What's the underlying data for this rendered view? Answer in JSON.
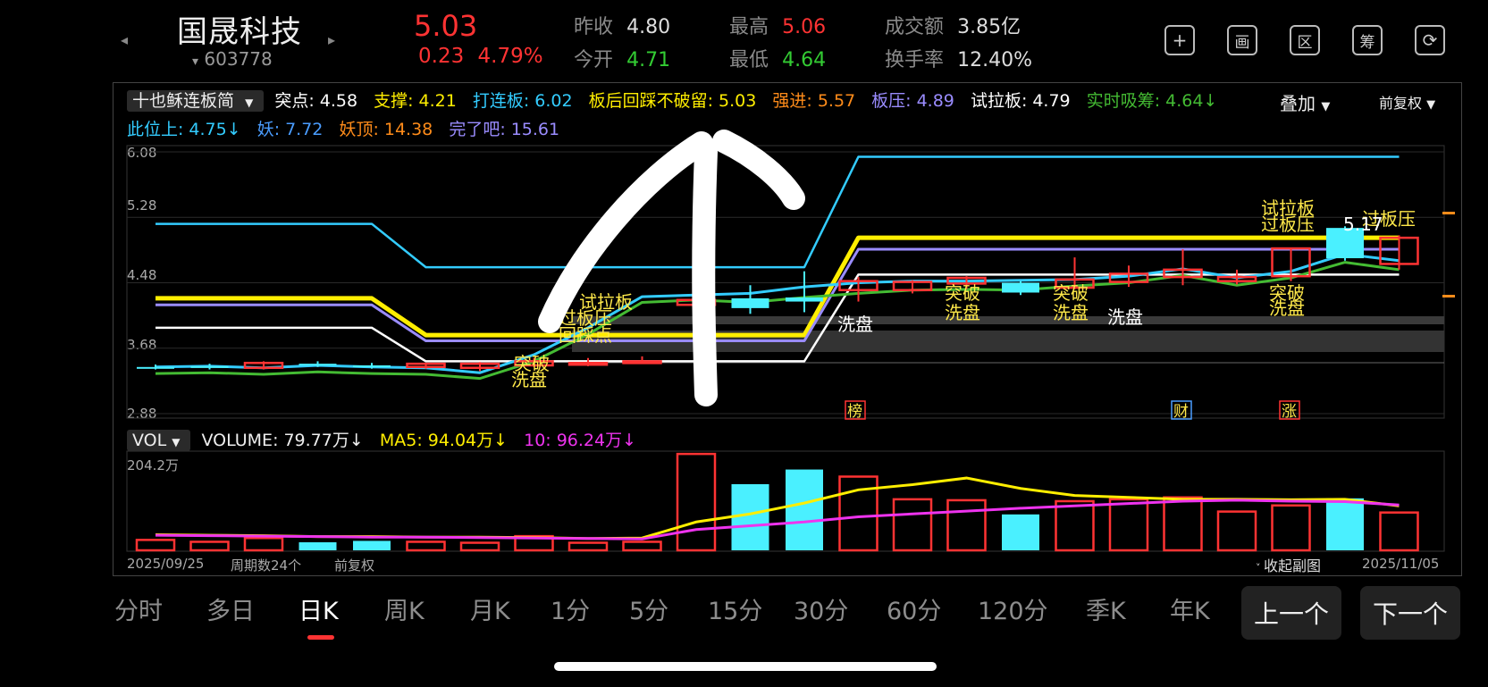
{
  "header": {
    "prev_arrow": "◂",
    "next_arrow": "▸",
    "name": "国晟科技",
    "code_caret": "▾",
    "code": "603778",
    "price": "5.03",
    "change": "0.23",
    "change_pct": "4.79%",
    "stats": {
      "prev_close_label": "昨收",
      "prev_close": "4.80",
      "open_label": "今开",
      "open": "4.71",
      "high_label": "最高",
      "high": "5.06",
      "low_label": "最低",
      "low": "4.64",
      "amount_label": "成交额",
      "amount": "3.85亿",
      "turnover_label": "换手率",
      "turnover": "12.40%"
    },
    "icons": [
      {
        "name": "add-icon",
        "glyph": "+"
      },
      {
        "name": "draw-icon",
        "glyph": "画"
      },
      {
        "name": "range-icon",
        "glyph": "区"
      },
      {
        "name": "chip-icon",
        "glyph": "筹"
      },
      {
        "name": "rotate-icon",
        "glyph": "⟳"
      }
    ]
  },
  "colors": {
    "up": "#ff3333",
    "down": "#33cc33",
    "yellow": "#ffee00",
    "cyan": "#33ccff",
    "purple": "#9a8cff",
    "white": "#ffffff",
    "green": "#44bb33",
    "orange": "#ff8c1a",
    "magenta": "#ee33ee",
    "candle_cyan": "#4af0ff"
  },
  "indicator": {
    "selector": "十也稣连板简",
    "items_row1": [
      {
        "label": "突点:",
        "value": "4.58",
        "color": "#ffffff"
      },
      {
        "label": "支撑:",
        "value": "4.21",
        "color": "#ffee00"
      },
      {
        "label": "打连板:",
        "value": "6.02",
        "color": "#33ccff"
      },
      {
        "label": "板后回踩不破留:",
        "value": "5.03",
        "color": "#ffee00"
      },
      {
        "label": "强进:",
        "value": "5.57",
        "color": "#ff8c1a"
      },
      {
        "label": "板压:",
        "value": "4.89",
        "color": "#9a8cff"
      },
      {
        "label": "试拉板:",
        "value": "4.79",
        "color": "#ffffff"
      },
      {
        "label": "实时吸筹:",
        "value": "4.64↓",
        "color": "#44bb33"
      }
    ],
    "items_row2": [
      {
        "label": "此位上:",
        "value": "4.75↓",
        "color": "#33ccff"
      },
      {
        "label": "妖:",
        "value": "7.72",
        "color": "#4a9dff"
      },
      {
        "label": "妖顶:",
        "value": "14.38",
        "color": "#ff8c1a"
      },
      {
        "label": "完了吧:",
        "value": "15.61",
        "color": "#9a8cff"
      }
    ],
    "overlay": "叠加",
    "adjust": "前复权"
  },
  "price_axis": [
    "6.08",
    "5.28",
    "4.48",
    "3.68",
    "2.88"
  ],
  "annotations": {
    "tulaban": "试拉板",
    "guobanya": "过板压",
    "xipan": "洗盘",
    "tupo": "突破",
    "huicaidian": "回踩点",
    "bang": "榜",
    "cai": "财",
    "zhang": "涨",
    "last_close_hint": "5.17"
  },
  "volume": {
    "selector": "VOL",
    "volume_label": "VOLUME:",
    "volume_value": "79.77万↓",
    "ma5_label": "MA5:",
    "ma5_value": "94.04万↓",
    "ma10_label": "10:",
    "ma10_value": "96.24万↓",
    "axis_max": "204.2万"
  },
  "footer": {
    "start_date": "2025/09/25",
    "period_count": "周期数24个",
    "adjust": "前复权",
    "collapse": "收起副图",
    "end_date": "2025/11/05"
  },
  "tabs": [
    "分时",
    "多日",
    "日K",
    "周K",
    "月K",
    "1分",
    "5分",
    "15分",
    "30分",
    "60分",
    "120分",
    "季K",
    "年K"
  ],
  "active_tab": "日K",
  "nav": {
    "prev": "上一个",
    "next": "下一个"
  },
  "chart_data": {
    "type": "candlestick",
    "x": [
      "2025/09/25",
      "",
      "",
      "",
      "",
      "",
      "",
      "",
      "",
      "",
      "",
      "",
      "",
      "",
      "",
      "",
      "",
      "",
      "",
      "",
      "",
      "",
      "",
      "2025/11/05"
    ],
    "ylim": [
      2.88,
      6.08
    ],
    "candles": [
      {
        "o": 3.45,
        "c": 3.45,
        "h": 3.48,
        "l": 3.42,
        "up": false
      },
      {
        "o": 3.46,
        "c": 3.44,
        "h": 3.49,
        "l": 3.42,
        "up": false
      },
      {
        "o": 3.44,
        "c": 3.5,
        "h": 3.52,
        "l": 3.42,
        "up": true
      },
      {
        "o": 3.49,
        "c": 3.47,
        "h": 3.52,
        "l": 3.45,
        "up": false
      },
      {
        "o": 3.47,
        "c": 3.45,
        "h": 3.5,
        "l": 3.43,
        "up": false
      },
      {
        "o": 3.45,
        "c": 3.49,
        "h": 3.5,
        "l": 3.43,
        "up": true
      },
      {
        "o": 3.44,
        "c": 3.49,
        "h": 3.51,
        "l": 3.4,
        "up": true
      },
      {
        "o": 3.47,
        "c": 3.52,
        "h": 3.56,
        "l": 3.45,
        "up": true
      },
      {
        "o": 3.5,
        "c": 3.5,
        "h": 3.56,
        "l": 3.46,
        "up": true
      },
      {
        "o": 3.52,
        "c": 3.52,
        "h": 3.58,
        "l": 3.49,
        "up": true
      },
      {
        "o": 4.21,
        "c": 4.27,
        "h": 4.3,
        "l": 4.21,
        "up": true
      },
      {
        "o": 4.29,
        "c": 4.17,
        "h": 4.45,
        "l": 4.1,
        "up": false
      },
      {
        "o": 4.3,
        "c": 4.25,
        "h": 4.62,
        "l": 4.12,
        "up": false
      },
      {
        "o": 4.39,
        "c": 4.5,
        "h": 4.55,
        "l": 4.25,
        "up": true
      },
      {
        "o": 4.39,
        "c": 4.49,
        "h": 4.51,
        "l": 4.35,
        "up": true
      },
      {
        "o": 4.47,
        "c": 4.54,
        "h": 4.56,
        "l": 4.4,
        "up": true
      },
      {
        "o": 4.48,
        "c": 4.36,
        "h": 4.5,
        "l": 4.33,
        "up": false
      },
      {
        "o": 4.42,
        "c": 4.52,
        "h": 4.79,
        "l": 4.4,
        "up": true
      },
      {
        "o": 4.49,
        "c": 4.59,
        "h": 4.69,
        "l": 4.43,
        "up": true
      },
      {
        "o": 4.55,
        "c": 4.64,
        "h": 4.89,
        "l": 4.45,
        "up": true
      },
      {
        "o": 4.55,
        "c": 4.5,
        "h": 4.64,
        "l": 4.46,
        "up": true
      },
      {
        "o": 4.9,
        "c": 4.56,
        "h": 4.9,
        "l": 4.5,
        "up": true
      },
      {
        "o": 5.15,
        "c": 4.78,
        "h": 5.17,
        "l": 4.75,
        "up": false
      },
      {
        "o": 4.71,
        "c": 5.03,
        "h": 5.06,
        "l": 4.64,
        "up": true
      }
    ],
    "series": [
      {
        "name": "打连板",
        "values": [
          5.2,
          5.2,
          5.2,
          5.2,
          5.2,
          4.67,
          4.67,
          4.67,
          4.67,
          4.67,
          4.67,
          4.67,
          4.67,
          6.02,
          6.02,
          6.02,
          6.02,
          6.02,
          6.02,
          6.02,
          6.02,
          6.02,
          6.02,
          6.02
        ]
      },
      {
        "name": "板后回踩不破留",
        "values": [
          4.29,
          4.29,
          4.29,
          4.29,
          4.29,
          3.84,
          3.84,
          3.84,
          3.84,
          3.84,
          3.84,
          3.84,
          3.84,
          5.03,
          5.03,
          5.03,
          5.03,
          5.03,
          5.03,
          5.03,
          5.03,
          5.03,
          5.03,
          5.03
        ]
      },
      {
        "name": "板压",
        "values": [
          4.21,
          4.21,
          4.21,
          4.21,
          4.21,
          3.77,
          3.77,
          3.77,
          3.77,
          3.77,
          3.77,
          3.77,
          3.77,
          4.89,
          4.89,
          4.89,
          4.89,
          4.89,
          4.89,
          4.89,
          4.89,
          4.89,
          4.89,
          4.89
        ]
      },
      {
        "name": "突点",
        "values": [
          3.93,
          3.93,
          3.93,
          3.93,
          3.93,
          3.52,
          3.52,
          3.52,
          3.52,
          3.52,
          3.52,
          3.52,
          3.52,
          4.58,
          4.58,
          4.58,
          4.58,
          4.58,
          4.58,
          4.58,
          4.58,
          4.58,
          4.58,
          4.58
        ]
      },
      {
        "name": "此位上",
        "values": [
          3.45,
          3.46,
          3.44,
          3.47,
          3.45,
          3.44,
          3.38,
          3.6,
          3.93,
          4.31,
          4.33,
          4.35,
          4.43,
          4.48,
          4.5,
          4.5,
          4.51,
          4.52,
          4.56,
          4.65,
          4.54,
          4.62,
          4.83,
          4.75
        ]
      },
      {
        "name": "实时吸筹",
        "values": [
          3.37,
          3.38,
          3.36,
          3.39,
          3.37,
          3.36,
          3.31,
          3.52,
          3.85,
          4.24,
          4.27,
          4.24,
          4.3,
          4.35,
          4.39,
          4.4,
          4.39,
          4.44,
          4.48,
          4.57,
          4.45,
          4.54,
          4.73,
          4.64
        ]
      }
    ],
    "volume": {
      "ylim": [
        0,
        204.2
      ],
      "unit": "万",
      "bars": [
        {
          "v": 22,
          "up": true
        },
        {
          "v": 18,
          "up": true
        },
        {
          "v": 26,
          "up": true
        },
        {
          "v": 17,
          "up": false
        },
        {
          "v": 20,
          "up": false
        },
        {
          "v": 18,
          "up": true
        },
        {
          "v": 16,
          "up": true
        },
        {
          "v": 30,
          "up": true
        },
        {
          "v": 16,
          "up": true
        },
        {
          "v": 18,
          "up": true
        },
        {
          "v": 204,
          "up": true
        },
        {
          "v": 140,
          "up": false
        },
        {
          "v": 171,
          "up": false
        },
        {
          "v": 156,
          "up": true
        },
        {
          "v": 108,
          "up": true
        },
        {
          "v": 106,
          "up": true
        },
        {
          "v": 76,
          "up": false
        },
        {
          "v": 104,
          "up": true
        },
        {
          "v": 108,
          "up": true
        },
        {
          "v": 112,
          "up": true
        },
        {
          "v": 82,
          "up": true
        },
        {
          "v": 95,
          "up": true
        },
        {
          "v": 110,
          "up": false
        },
        {
          "v": 80,
          "up": true
        }
      ],
      "ma5": [
        33,
        32,
        31,
        29,
        29,
        28,
        28,
        27,
        25,
        26,
        60,
        77,
        100,
        128,
        139,
        153,
        131,
        116,
        112,
        108,
        108,
        107,
        108,
        94
      ],
      "ma10": [
        32,
        31,
        30,
        29,
        28,
        28,
        27,
        26,
        25,
        24,
        44,
        52,
        60,
        71,
        77,
        83,
        89,
        94,
        99,
        104,
        106,
        104,
        103,
        96
      ]
    }
  }
}
